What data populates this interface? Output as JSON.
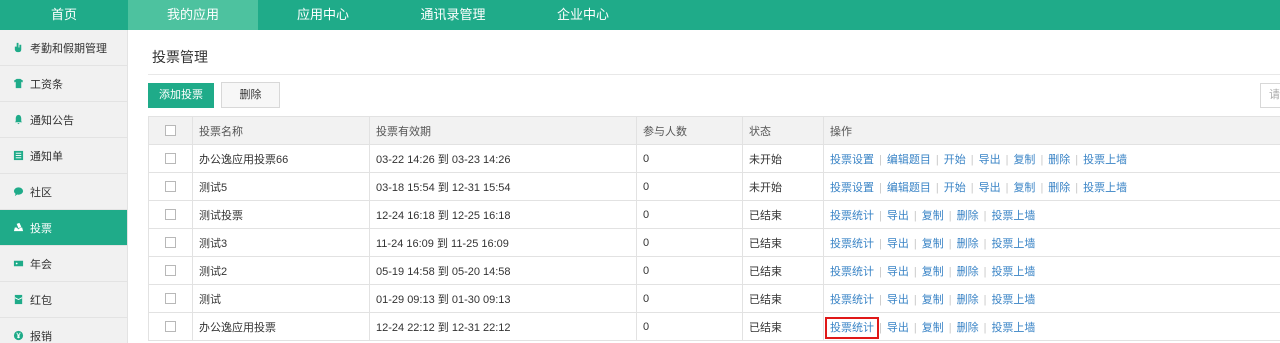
{
  "topnav": [
    {
      "label": "首页",
      "active": false
    },
    {
      "label": "我的应用",
      "active": true
    },
    {
      "label": "应用中心",
      "active": false
    },
    {
      "label": "通讯录管理",
      "active": false
    },
    {
      "label": "企业中心",
      "active": false
    }
  ],
  "sidebar": [
    {
      "label": "考勤和假期管理",
      "icon": "hand-icon",
      "active": false
    },
    {
      "label": "工资条",
      "icon": "tshirt-icon",
      "active": false
    },
    {
      "label": "通知公告",
      "icon": "bell-icon",
      "active": false
    },
    {
      "label": "通知单",
      "icon": "list-icon",
      "active": false
    },
    {
      "label": "社区",
      "icon": "chat-icon",
      "active": false
    },
    {
      "label": "投票",
      "icon": "vote-icon",
      "active": true
    },
    {
      "label": "年会",
      "icon": "ticket-icon",
      "active": false
    },
    {
      "label": "红包",
      "icon": "envelope-icon",
      "active": false
    },
    {
      "label": "报销",
      "icon": "yen-icon",
      "active": false
    }
  ],
  "main": {
    "title": "投票管理",
    "add_label": "添加投票",
    "delete_label": "删除",
    "search_placeholder": "请"
  },
  "table": {
    "headers": [
      "",
      "投票名称",
      "投票有效期",
      "参与人数",
      "状态",
      "操作"
    ],
    "rows": [
      {
        "name": "办公逸应用投票66",
        "period": "03-22 14:26 到 03-23 14:26",
        "count": "0",
        "status": "未开始",
        "ops": [
          "投票设置",
          "编辑题目",
          "开始",
          "导出",
          "复制",
          "删除",
          "投票上墙"
        ]
      },
      {
        "name": "测试5",
        "period": "03-18 15:54 到 12-31 15:54",
        "count": "0",
        "status": "未开始",
        "ops": [
          "投票设置",
          "编辑题目",
          "开始",
          "导出",
          "复制",
          "删除",
          "投票上墙"
        ]
      },
      {
        "name": "测试投票",
        "period": "12-24 16:18 到 12-25 16:18",
        "count": "0",
        "status": "已结束",
        "ops": [
          "投票统计",
          "导出",
          "复制",
          "删除",
          "投票上墙"
        ]
      },
      {
        "name": "测试3",
        "period": "11-24 16:09 到 11-25 16:09",
        "count": "0",
        "status": "已结束",
        "ops": [
          "投票统计",
          "导出",
          "复制",
          "删除",
          "投票上墙"
        ]
      },
      {
        "name": "测试2",
        "period": "05-19 14:58 到 05-20 14:58",
        "count": "0",
        "status": "已结束",
        "ops": [
          "投票统计",
          "导出",
          "复制",
          "删除",
          "投票上墙"
        ]
      },
      {
        "name": "测试",
        "period": "01-29 09:13 到 01-30 09:13",
        "count": "0",
        "status": "已结束",
        "ops": [
          "投票统计",
          "导出",
          "复制",
          "删除",
          "投票上墙"
        ]
      },
      {
        "name": "办公逸应用投票",
        "period": "12-24 22:12 到 12-31 22:12",
        "count": "0",
        "status": "已结束",
        "ops": [
          "投票统计",
          "导出",
          "复制",
          "删除",
          "投票上墙"
        ],
        "highlight_op": "投票统计"
      }
    ]
  },
  "colors": {
    "brand": "#1fab89",
    "brand_active": "#4dc29f",
    "link": "#3a84c6",
    "highlight_box": "#e01818"
  }
}
